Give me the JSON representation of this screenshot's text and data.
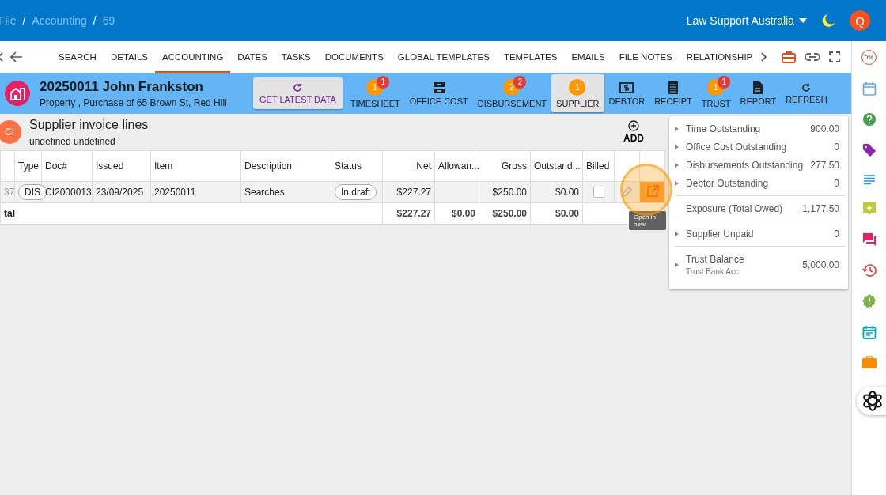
{
  "breadcrumb": [
    "File",
    "Accounting",
    "69"
  ],
  "breadcrumb_separator": "/",
  "org": {
    "name": "Law Support Australia"
  },
  "avatar": "Q",
  "tabs": [
    {
      "label": "SEARCH",
      "selected": false
    },
    {
      "label": "DETAILS",
      "selected": false
    },
    {
      "label": "ACCOUNTING",
      "selected": true
    },
    {
      "label": "DATES",
      "selected": false
    },
    {
      "label": "TASKS",
      "selected": false
    },
    {
      "label": "DOCUMENTS",
      "selected": false
    },
    {
      "label": "GLOBAL TEMPLATES",
      "selected": false
    },
    {
      "label": "TEMPLATES",
      "selected": false
    },
    {
      "label": "EMAILS",
      "selected": false
    },
    {
      "label": "FILE NOTES",
      "selected": false
    },
    {
      "label": "RELATIONSHIP",
      "selected": false
    }
  ],
  "matter": {
    "title": "20250011 John Frankston",
    "subtitle": "Property , Purchase of 65 Brown St, Red Hill"
  },
  "actions": [
    {
      "kind": "refresh-big",
      "label": "GET LATEST DATA"
    },
    {
      "kind": "badge",
      "label": "TIMESHEET",
      "count": "1",
      "alert": "1",
      "selected": false
    },
    {
      "kind": "inbox",
      "label": "OFFICE COST",
      "selected": false
    },
    {
      "kind": "badge",
      "label": "DISBURSEMENT",
      "count": "2",
      "alert": "2",
      "selected": false
    },
    {
      "kind": "badge",
      "label": "SUPPLIER",
      "count": "1",
      "selected": true
    },
    {
      "kind": "dollar",
      "label": "DEBTOR",
      "selected": false
    },
    {
      "kind": "receipt",
      "label": "RECEIPT",
      "selected": false
    },
    {
      "kind": "badge",
      "label": "TRUST",
      "count": "1",
      "alert": "1",
      "selected": false
    },
    {
      "kind": "document",
      "label": "REPORT",
      "selected": false
    },
    {
      "kind": "refresh",
      "label": "REFRESH",
      "selected": false
    }
  ],
  "section": {
    "avatar": "CI",
    "title": "Supplier invoice lines",
    "subtitle": "undefined undefined",
    "add": "ADD"
  },
  "table": {
    "columns": [
      "",
      "Type",
      "Doc#",
      "Issued",
      "Item",
      "Description",
      "Status",
      "Net",
      "Allowan...",
      "Gross",
      "Outstand...",
      "Billed",
      "",
      ""
    ],
    "rows": [
      {
        "column_1": "37",
        "type": "DIS",
        "doc": "CI2000013",
        "issued": "23/09/2025",
        "item": "20250011",
        "description": "Searches",
        "status": "In draft",
        "net": "$227.27",
        "allowance": "",
        "gross": "$250.00",
        "outstanding": "$0.00",
        "billed": false
      }
    ],
    "total": {
      "label": "tal",
      "net": "$227.27",
      "allowance": "$0.00",
      "gross": "$250.00",
      "outstanding": "$0.00"
    }
  },
  "tooltip": "Open in new",
  "summary": [
    {
      "items": [
        {
          "label": "Time Outstanding",
          "value": "900.00",
          "expandable": true
        },
        {
          "label": "Office Cost Outstanding",
          "value": "0",
          "expandable": true
        },
        {
          "label": "Disbursements Outstanding",
          "value": "277.50",
          "expandable": true
        },
        {
          "label": "Debtor Outstanding",
          "value": "0",
          "expandable": true
        }
      ]
    },
    {
      "items": [
        {
          "label": "Exposure (Total Owed)",
          "value": "1,177.50",
          "expandable": false
        }
      ]
    },
    {
      "items": [
        {
          "label": "Supplier Unpaid",
          "value": "0",
          "expandable": true
        }
      ]
    },
    {
      "items": [
        {
          "label": "Trust Balance",
          "sub": "Trust Bank Acc",
          "value": "5,000.00",
          "expandable": true
        }
      ]
    }
  ],
  "rail": [
    {
      "kind": "progress",
      "text": "0%"
    },
    {
      "kind": "calendar"
    },
    {
      "kind": "help"
    },
    {
      "kind": "tag"
    },
    {
      "kind": "notes"
    },
    {
      "kind": "comment"
    },
    {
      "kind": "chat"
    },
    {
      "kind": "history"
    },
    {
      "kind": "alert"
    },
    {
      "kind": "event"
    },
    {
      "kind": "briefcase"
    }
  ]
}
